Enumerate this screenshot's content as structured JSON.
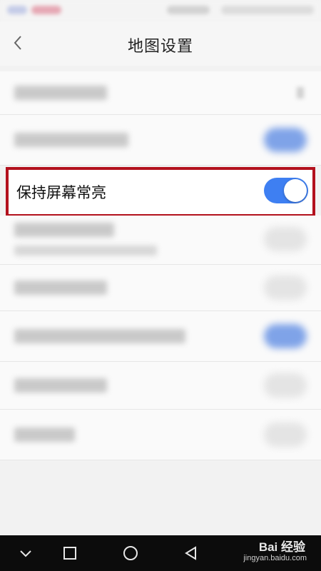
{
  "header": {
    "title": "地图设置"
  },
  "settings": {
    "keep_screen_on": {
      "label": "保持屏幕常亮",
      "enabled": true
    }
  },
  "colors": {
    "accent": "#3e7ff2",
    "highlight_border": "#b3111d"
  },
  "navbar": {
    "icons": [
      "chevron-down-icon",
      "square-icon",
      "circle-icon",
      "triangle-back-icon"
    ]
  },
  "watermark": {
    "brand": "Bai 经验",
    "url": "jingyan.baidu.com"
  }
}
